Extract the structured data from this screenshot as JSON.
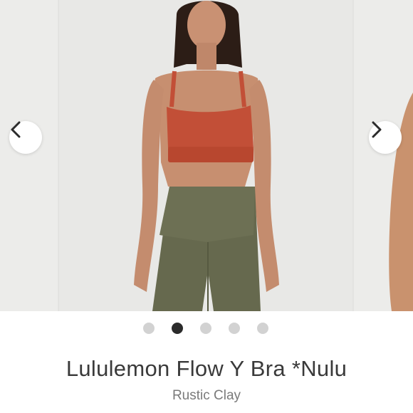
{
  "carousel": {
    "prev_icon": "chevron-left-icon",
    "next_icon": "chevron-right-icon",
    "slide_count": 5,
    "active_index": 1,
    "colors": {
      "bra": "#c24f37",
      "leggings": "#66694e",
      "background": "#e6e6e4",
      "dot_active": "#2b2b2b",
      "dot_inactive": "#d2d2d2"
    }
  },
  "product": {
    "title": "Lululemon Flow Y Bra *Nulu",
    "color_name": "Rustic Clay"
  }
}
